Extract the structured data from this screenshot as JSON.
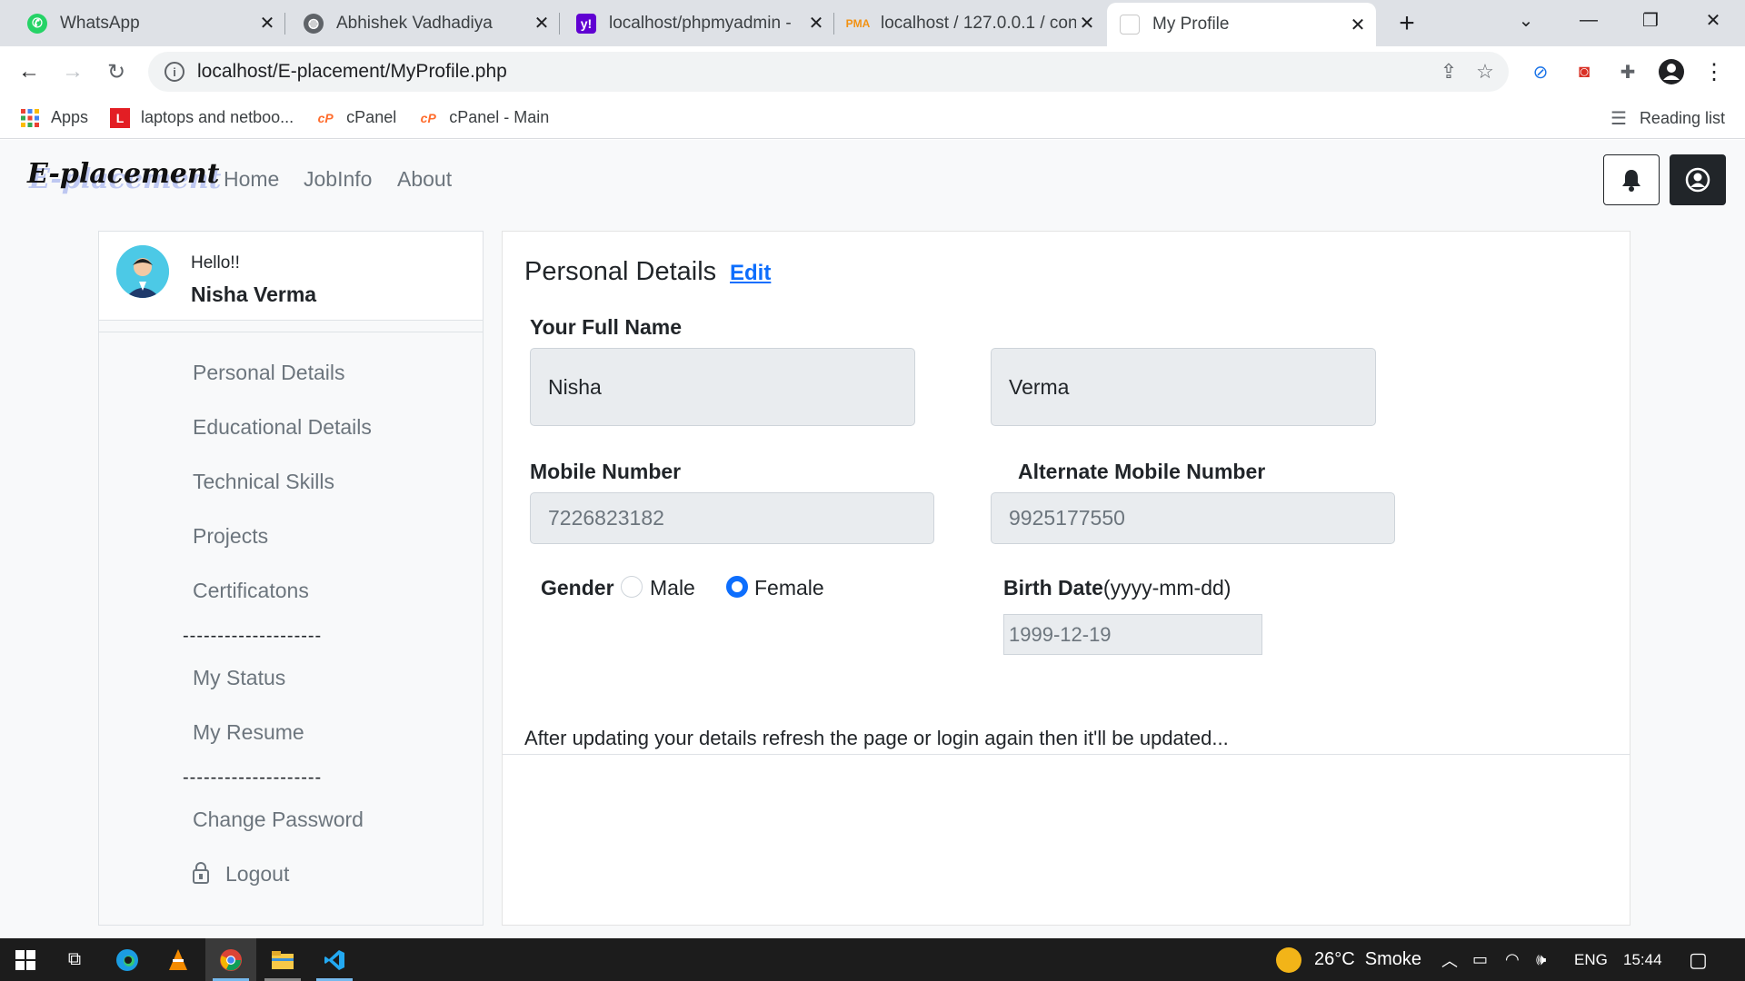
{
  "browser": {
    "tabs": [
      {
        "title": "WhatsApp"
      },
      {
        "title": "Abhishek Vadhadiya"
      },
      {
        "title": "localhost/phpmyadmin -"
      },
      {
        "title": "localhost / 127.0.0.1 / con"
      },
      {
        "title": "My Profile"
      }
    ],
    "url": "localhost/E-placement/MyProfile.php",
    "bookmarks": [
      {
        "label": "Apps"
      },
      {
        "label": "laptops and netboo..."
      },
      {
        "label": "cPanel"
      },
      {
        "label": "cPanel - Main"
      }
    ],
    "reading_list": "Reading list"
  },
  "site": {
    "brand": "E-placement",
    "nav": [
      {
        "label": "Home"
      },
      {
        "label": "JobInfo"
      },
      {
        "label": "About"
      }
    ]
  },
  "sidebar": {
    "greeting": "Hello!!",
    "user_name": "Nisha Verma",
    "items": [
      {
        "label": "Personal Details"
      },
      {
        "label": "Educational Details"
      },
      {
        "label": "Technical Skills"
      },
      {
        "label": "Projects"
      },
      {
        "label": "Certificatons"
      },
      {
        "label": "My Status"
      },
      {
        "label": "My Resume"
      },
      {
        "label": "Change Password"
      },
      {
        "label": "Logout"
      }
    ],
    "separator": "--------------------"
  },
  "profile": {
    "title": "Personal Details",
    "edit_label": "Edit",
    "full_name_label": "Your Full Name",
    "first_name": "Nisha",
    "last_name": "Verma",
    "mobile_label": "Mobile Number",
    "mobile_value": "7226823182",
    "alt_mobile_label": "Alternate Mobile Number",
    "alt_mobile_value": "9925177550",
    "gender_label": "Gender",
    "gender_options": [
      "Male",
      "Female"
    ],
    "gender_selected": "Female",
    "birth_label": "Birth Date",
    "birth_format": "(yyyy-mm-dd)",
    "birth_value": "1999-12-19",
    "note": "After updating your details refresh the page or login again then it'll be updated..."
  },
  "taskbar": {
    "weather": "26°C  Smoke",
    "language": "ENG",
    "time": "15:44"
  },
  "colors": {
    "primary": "#0d6efd",
    "navbar_bg": "#f8f9fa",
    "input_bg": "#e9ecef",
    "taskbar_bg": "#1c1c1c"
  }
}
